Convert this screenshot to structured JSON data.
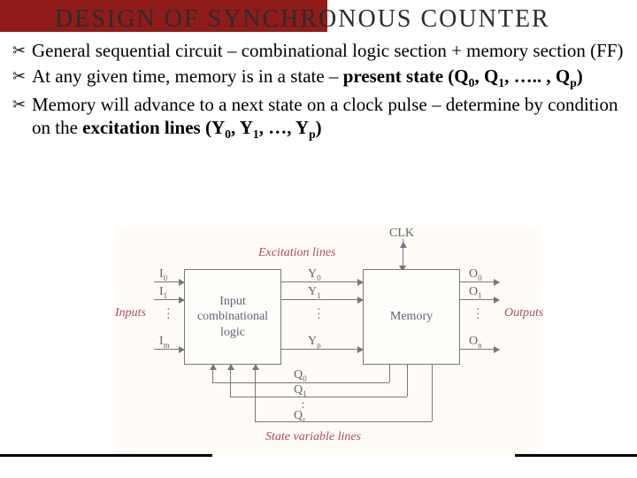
{
  "title": "DESIGN OF SYNCHRONOUS COUNTER",
  "bullets": {
    "b1_pre": "General sequential circuit – combinational logic section + memory section (FF)",
    "b2_pre": "At any given time, memory is in a state – ",
    "b2_bold1": "present state (Q",
    "b2_q0": "0",
    "b2_mid1": ", Q",
    "b2_q1": "1",
    "b2_mid2": ", ….. , Q",
    "b2_qp": "p",
    "b2_close": ")",
    "b3_pre": "Memory will advance to a next state on a clock pulse – determine by condition on the ",
    "b3_bold1": "excitation lines (Y",
    "b3_y0": "0",
    "b3_mid1": ", Y",
    "b3_y1": "1",
    "b3_mid2": ", …, Y",
    "b3_yp": "p",
    "b3_close": ")"
  },
  "diagram": {
    "clk": "CLK",
    "excitation": "Excitation lines",
    "inputs_label": "Inputs",
    "outputs_label": "Outputs",
    "box_logic": "Input combinational logic",
    "box_memory": "Memory",
    "i0": "I",
    "i0s": "0",
    "i1": "I",
    "i1s": "1",
    "im": "I",
    "ims": "m",
    "y0": "Y",
    "y0s": "0",
    "y1": "Y",
    "y1s": "1",
    "yp": "Y",
    "yps": "p",
    "o0": "O",
    "o0s": "0",
    "o1": "O",
    "o1s": "1",
    "on": "O",
    "ons": "n",
    "q0": "Q",
    "q0s": "0",
    "q1": "Q",
    "q1s": "1",
    "qr": "Q",
    "qrs": "r",
    "statevar": "State variable lines"
  }
}
